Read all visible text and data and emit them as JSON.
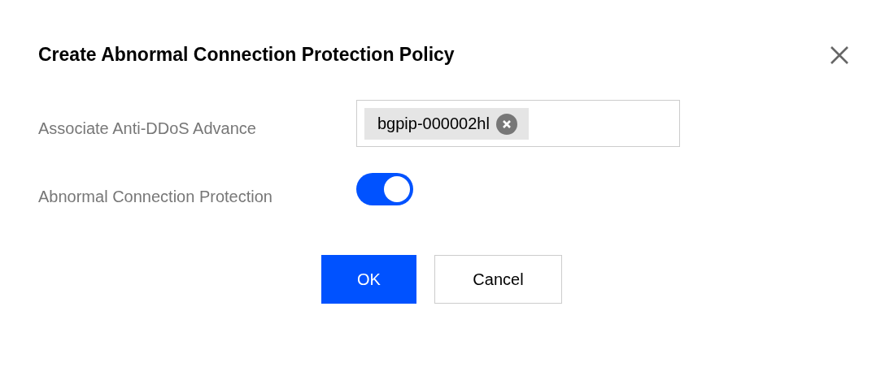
{
  "dialog": {
    "title": "Create Abnormal Connection Protection Policy"
  },
  "fields": [
    {
      "kind": "tags",
      "label": "Associate Anti-DDoS Advance",
      "tags": [
        "bgpip-000002hl"
      ]
    },
    {
      "kind": "switch",
      "label": "Abnormal Connection Protection",
      "on": true
    }
  ],
  "buttons": [
    {
      "label": "OK",
      "kind": "primary"
    },
    {
      "label": "Cancel",
      "kind": "secondary"
    }
  ]
}
